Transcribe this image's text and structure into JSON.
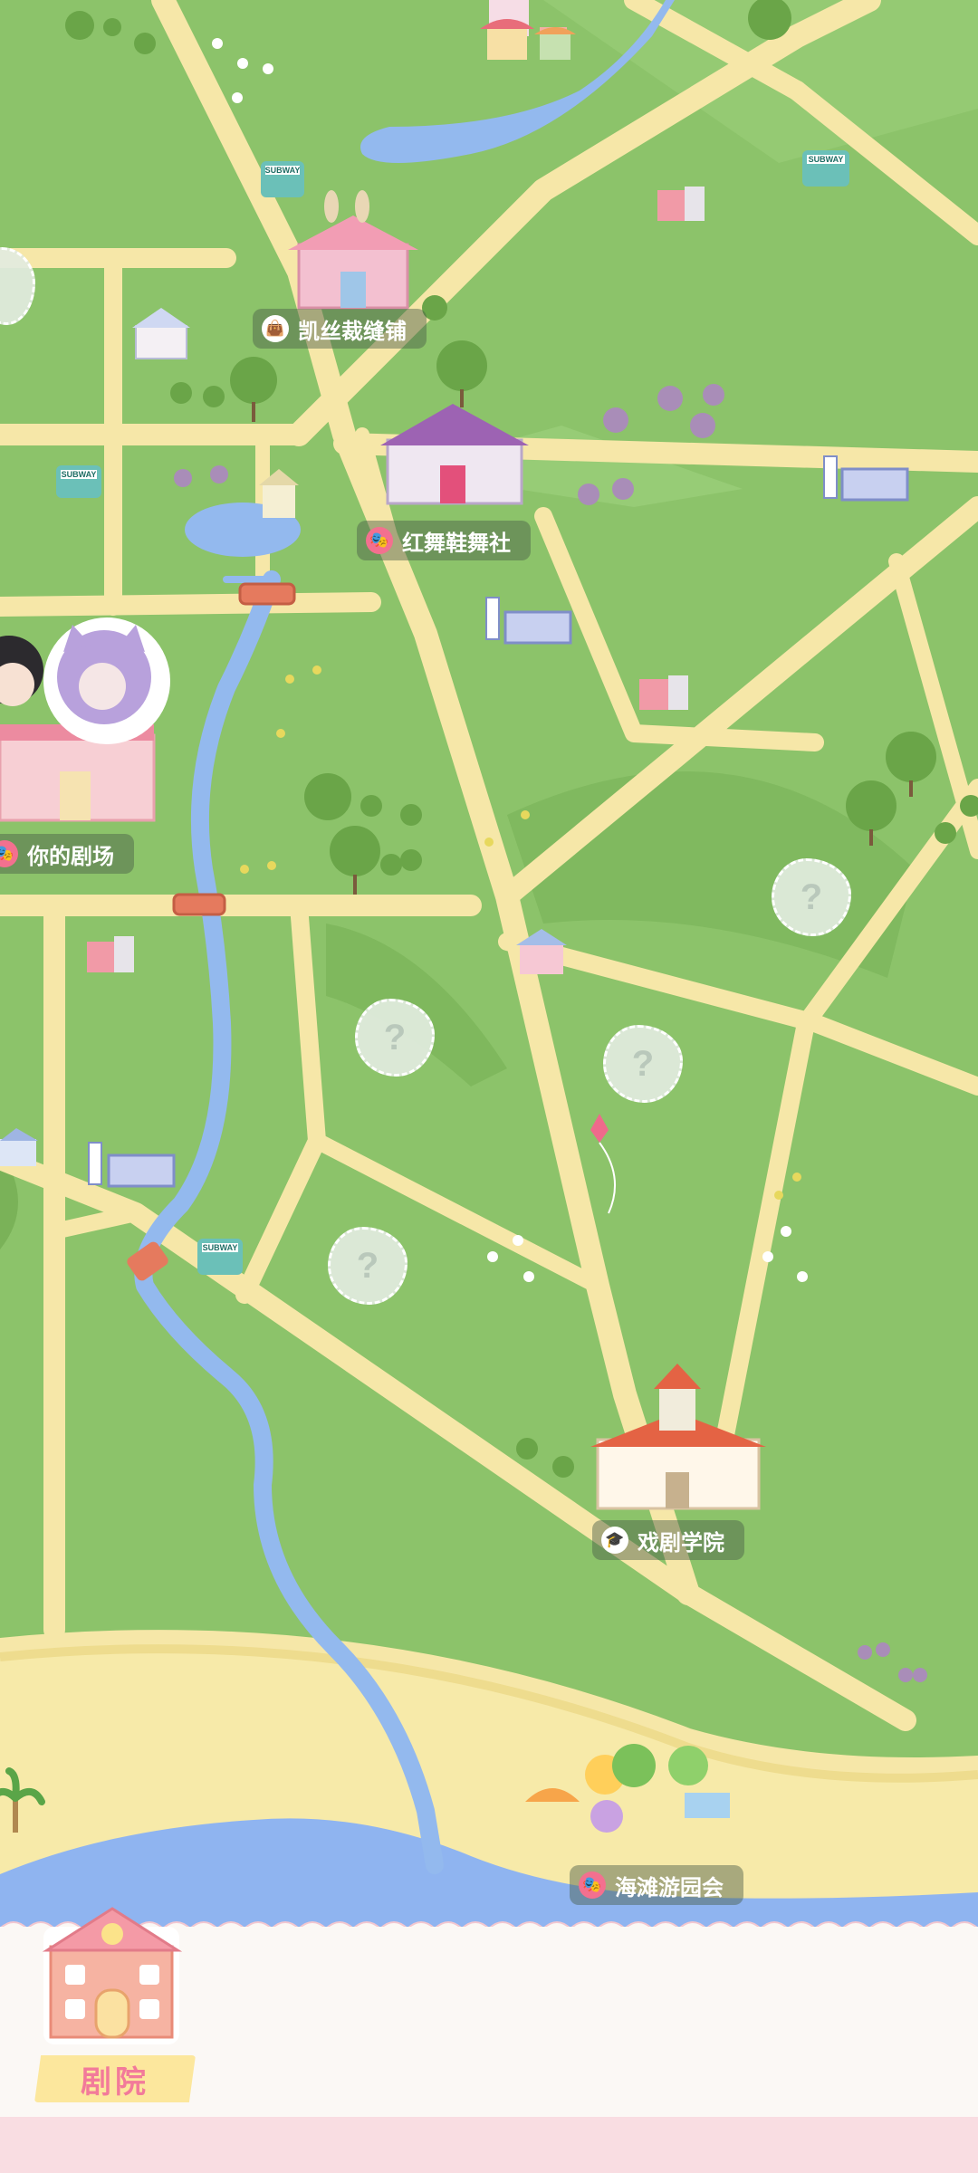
{
  "map": {
    "locations": [
      {
        "id": "kaisi",
        "label": "凯丝裁缝铺",
        "icon": "handbag-icon"
      },
      {
        "id": "hongwu",
        "label": "红舞鞋舞社",
        "icon": "theater-mask-icon"
      },
      {
        "id": "mytheater",
        "label": "你的剧场",
        "icon": "theater-mask-icon"
      },
      {
        "id": "academy",
        "label": "戏剧学院",
        "icon": "graduation-cap-icon"
      },
      {
        "id": "beach",
        "label": "海滩游园会",
        "icon": "theater-mask-icon"
      }
    ],
    "mystery_symbol": "?",
    "subway_sign": "SUBWAY"
  },
  "colors": {
    "grass": "#8cc36a",
    "road": "#f6e7a8",
    "river": "#93b9ee",
    "sand": "#f7eaa9",
    "sea": "#8fb4f0",
    "accent_pink": "#f27a9a"
  },
  "bottom_bar": {
    "theater_label": "剧院"
  }
}
